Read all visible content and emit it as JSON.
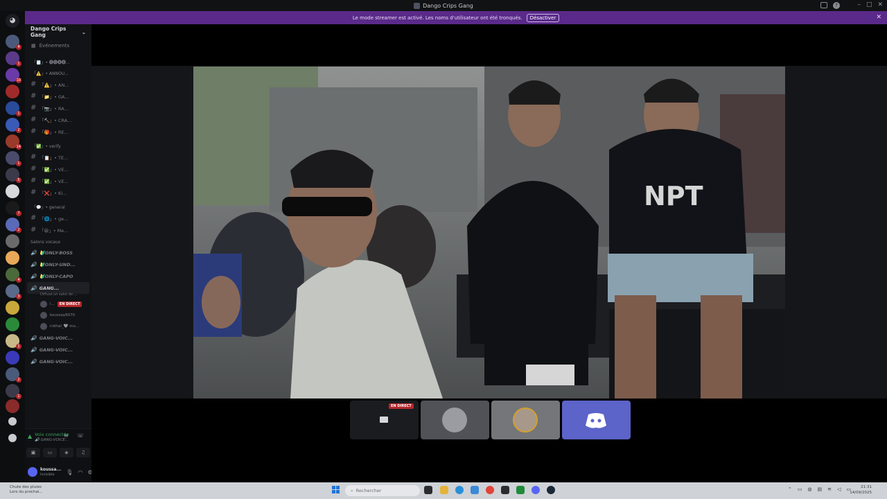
{
  "window": {
    "title": "Dango Crips Gang",
    "controls": [
      "–",
      "□",
      "✕"
    ]
  },
  "banner": {
    "text": "Le mode streamer est activé. Les noms d'utilisateur ont été tronqués.",
    "button": "Désactiver"
  },
  "server": {
    "name": "Dango Crips Gang",
    "events_label": "Événements"
  },
  "rail": {
    "servers": [
      {
        "color": "#4b5a7a",
        "badge": "4"
      },
      {
        "color": "#5b3a8a",
        "badge": "1"
      },
      {
        "color": "#6a3aa8",
        "badge": "10"
      },
      {
        "color": "#a02a2a",
        "badge": ""
      },
      {
        "color": "#2a4a9a",
        "badge": "1"
      },
      {
        "color": "#3a5ab8",
        "badge": "2"
      },
      {
        "color": "#9a3a2a",
        "badge": "14"
      },
      {
        "color": "#4a4a6a",
        "badge": "1"
      },
      {
        "color": "#3a3a4a",
        "badge": "5"
      },
      {
        "color": "#d6d8dc",
        "badge": ""
      },
      {
        "color": "#1a1a1a",
        "badge": "7"
      },
      {
        "color": "#5a6ab8",
        "badge": "2"
      },
      {
        "color": "#6a6a6a",
        "badge": ""
      },
      {
        "color": "#e8a858",
        "badge": ""
      },
      {
        "color": "#4a6a3a",
        "badge": "4"
      },
      {
        "color": "#5a6a8a",
        "badge": "3"
      },
      {
        "color": "#c8a83a",
        "badge": ""
      },
      {
        "color": "#2a8a3a",
        "badge": ""
      },
      {
        "color": "#c8b888",
        "badge": "1"
      },
      {
        "color": "#3a3ab8",
        "badge": ""
      },
      {
        "color": "#4a5a7a",
        "badge": "2"
      },
      {
        "color": "#3a3a4a",
        "badge": "1"
      },
      {
        "color": "#8a2a2a",
        "badge": ""
      }
    ]
  },
  "channels": {
    "cat1": "「🗒️」• 🅖🅞🅑🅑...",
    "cat2": "「⚠️」• ANNOU...",
    "group1": [
      "「⚠️」• AN...",
      "「📁」• GA...",
      "「📷」• RA...",
      "「🔨」• CRA...",
      "「🎁」• RE..."
    ],
    "cat3": "「✅」• verify",
    "group2": [
      "「📋」• TE...",
      "「✅」• VE...",
      "「✅」• VE...",
      "「❌」• KI..."
    ],
    "cat4": "「💬」• general",
    "group3": [
      "「🌐」• ge...",
      "「😀」• Me..."
    ],
    "voice_label": "Salons vocaux",
    "voice": [
      "🔰ONLY-BOSS",
      "🔰ONLY-UND...",
      "🔰ONLY-CAPO"
    ],
    "active_voice": "GANG...",
    "active_voice_sub": "Diffuse un salut de ...",
    "members": [
      {
        "name": "l...",
        "live": "EN DIRECT"
      },
      {
        "name": "koussay6070",
        "live": ""
      },
      {
        "name": "nidhal_🩶 mo...",
        "live": ""
      }
    ],
    "voice_more": [
      "GANG-VOIC...",
      "GANG-VOIC...",
      "GANG-VOIC..."
    ]
  },
  "voice_panel": {
    "status": "Voix connectée",
    "channel": "🔊 GANG-VOICE..."
  },
  "user": {
    "name": "koussa...",
    "status": "Invisible"
  },
  "stage": {
    "tile_live": "EN DIRECT"
  },
  "taskbar": {
    "weather_line1": "Chute des pluies",
    "weather_line2": "Lors du prochai...",
    "search": "Rechercher",
    "time": "21:31",
    "date": "14/09/2025"
  },
  "colors": {
    "banner": "#5a2a8a",
    "voice_green": "#3ba55d",
    "live_red": "#b4272c",
    "blurple": "#5c63c9"
  }
}
